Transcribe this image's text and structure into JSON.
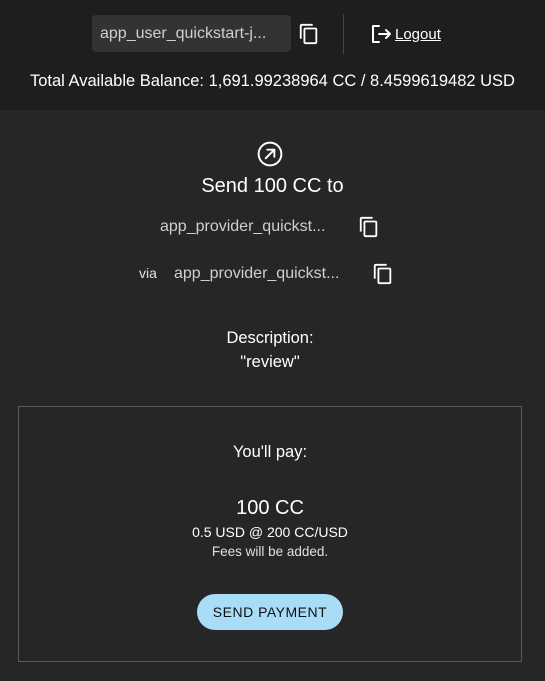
{
  "header": {
    "username": "app_user_quickstart-j...",
    "logout_label": "Logout",
    "balance": "Total Available Balance: 1,691.99238964 CC / 8.4599619482 USD"
  },
  "transfer": {
    "title": "Send 100 CC to",
    "recipient": "app_provider_quickst...",
    "via_label": "via",
    "via_party": "app_provider_quickst...",
    "description_label": "Description:",
    "description_value": "\"review\""
  },
  "payment": {
    "youll_pay_label": "You'll pay:",
    "amount": "100 CC",
    "rate": "0.5 USD @ 200 CC/USD",
    "fees_note": "Fees will be added.",
    "send_button_label": "SEND PAYMENT"
  },
  "icons": {
    "copy": "copy-icon",
    "logout": "logout-icon",
    "send": "arrow-up-right-circle-icon"
  },
  "colors": {
    "background": "#262626",
    "header_background": "#1e1e1e",
    "button": "#a9dcf7"
  }
}
